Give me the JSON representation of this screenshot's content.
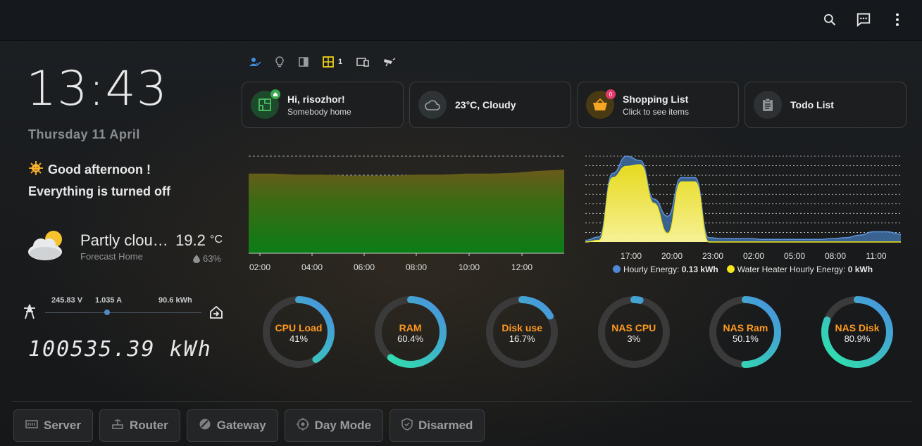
{
  "topbar": {
    "search_icon": "search-icon",
    "chat_icon": "chat-icon",
    "menu_icon": "more-vertical-icon"
  },
  "clock": {
    "time": "13:43",
    "date": "Thursday 11 April"
  },
  "greeting": {
    "emoji": "sun-face-icon",
    "line1": "Good afternoon !",
    "line2": "Everything is turned off"
  },
  "weather": {
    "condition": "Partly clou…",
    "source": "Forecast Home",
    "temp": "19.2",
    "unit": "°C",
    "humidity": "63%"
  },
  "power": {
    "voltage": "245.83 V",
    "current": "1.035 A",
    "energy": "90.6 kWh",
    "total": "100535.39 kWh"
  },
  "status_row": {
    "door_count": "1"
  },
  "cards": [
    {
      "title": "Hi, risozhor!",
      "subtitle": "Somebody home"
    },
    {
      "title": "23°C, Cloudy",
      "subtitle": ""
    },
    {
      "title": "Shopping List",
      "subtitle": "Click to see items",
      "badge": "0"
    },
    {
      "title": "Todo List",
      "subtitle": ""
    }
  ],
  "chart_data": [
    {
      "type": "area",
      "x": [
        "01:00",
        "02:00",
        "03:00",
        "04:00",
        "05:00",
        "06:00",
        "07:00",
        "08:00",
        "09:00",
        "10:00",
        "11:00",
        "12:00",
        "13:00",
        "13:43"
      ],
      "series": [
        {
          "values": [
            82,
            82,
            81,
            81,
            80,
            80,
            80,
            81,
            81,
            82,
            82,
            83,
            85,
            86
          ]
        }
      ],
      "x_tick_labels": [
        "02:00",
        "04:00",
        "06:00",
        "08:00",
        "10:00",
        "12:00"
      ],
      "ylim": [
        0,
        100
      ],
      "grid": true,
      "colors": [
        "#0a7d17",
        "#6b5a1a"
      ]
    },
    {
      "type": "area",
      "x": [
        "14:00",
        "15:00",
        "16:00",
        "17:00",
        "18:00",
        "19:00",
        "20:00",
        "21:00",
        "22:00",
        "23:00",
        "00:00",
        "01:00",
        "02:00",
        "03:00",
        "04:00",
        "05:00",
        "06:00",
        "07:00",
        "08:00",
        "09:00",
        "10:00",
        "11:00",
        "12:00",
        "13:00"
      ],
      "series": [
        {
          "name": "Hourly Energy",
          "values": [
            0.02,
            0.06,
            0.8,
            1.0,
            0.95,
            0.5,
            0.3,
            0.75,
            0.75,
            0.05,
            0.04,
            0.04,
            0.04,
            0.03,
            0.03,
            0.03,
            0.03,
            0.03,
            0.04,
            0.05,
            0.08,
            0.12,
            0.12,
            0.09
          ]
        },
        {
          "name": "Water Heater Hourly Energy",
          "values": [
            0,
            0.02,
            0.75,
            0.88,
            0.9,
            0.45,
            0.1,
            0.7,
            0.7,
            0,
            0,
            0,
            0,
            0,
            0,
            0,
            0,
            0,
            0,
            0,
            0,
            0,
            0,
            0
          ]
        }
      ],
      "x_tick_labels": [
        "17:00",
        "20:00",
        "23:00",
        "02:00",
        "05:00",
        "08:00",
        "11:00"
      ],
      "legend": [
        {
          "label": "Hourly Energy:",
          "value": "0.13 kWh",
          "color": "#4f88d9"
        },
        {
          "label": "Water Heater Hourly Energy:",
          "value": "0 kWh",
          "color": "#f3e61a"
        }
      ],
      "legend_position": "bottom",
      "grid": true
    }
  ],
  "gauges": [
    {
      "label": "CPU Load",
      "value": "41%",
      "fraction": 0.41
    },
    {
      "label": "RAM",
      "value": "60.4%",
      "fraction": 0.604
    },
    {
      "label": "Disk use",
      "value": "16.7%",
      "fraction": 0.167
    },
    {
      "label": "NAS CPU",
      "value": "3%",
      "fraction": 0.03
    },
    {
      "label": "NAS Ram",
      "value": "50.1%",
      "fraction": 0.501
    },
    {
      "label": "NAS Disk",
      "value": "80.9%",
      "fraction": 0.809
    }
  ],
  "footer": [
    {
      "label": "Server",
      "icon": "server-icon"
    },
    {
      "label": "Router",
      "icon": "router-icon"
    },
    {
      "label": "Gateway",
      "icon": "gateway-icon"
    },
    {
      "label": "Day Mode",
      "icon": "day-mode-icon"
    },
    {
      "label": "Disarmed",
      "icon": "shield-icon"
    }
  ]
}
